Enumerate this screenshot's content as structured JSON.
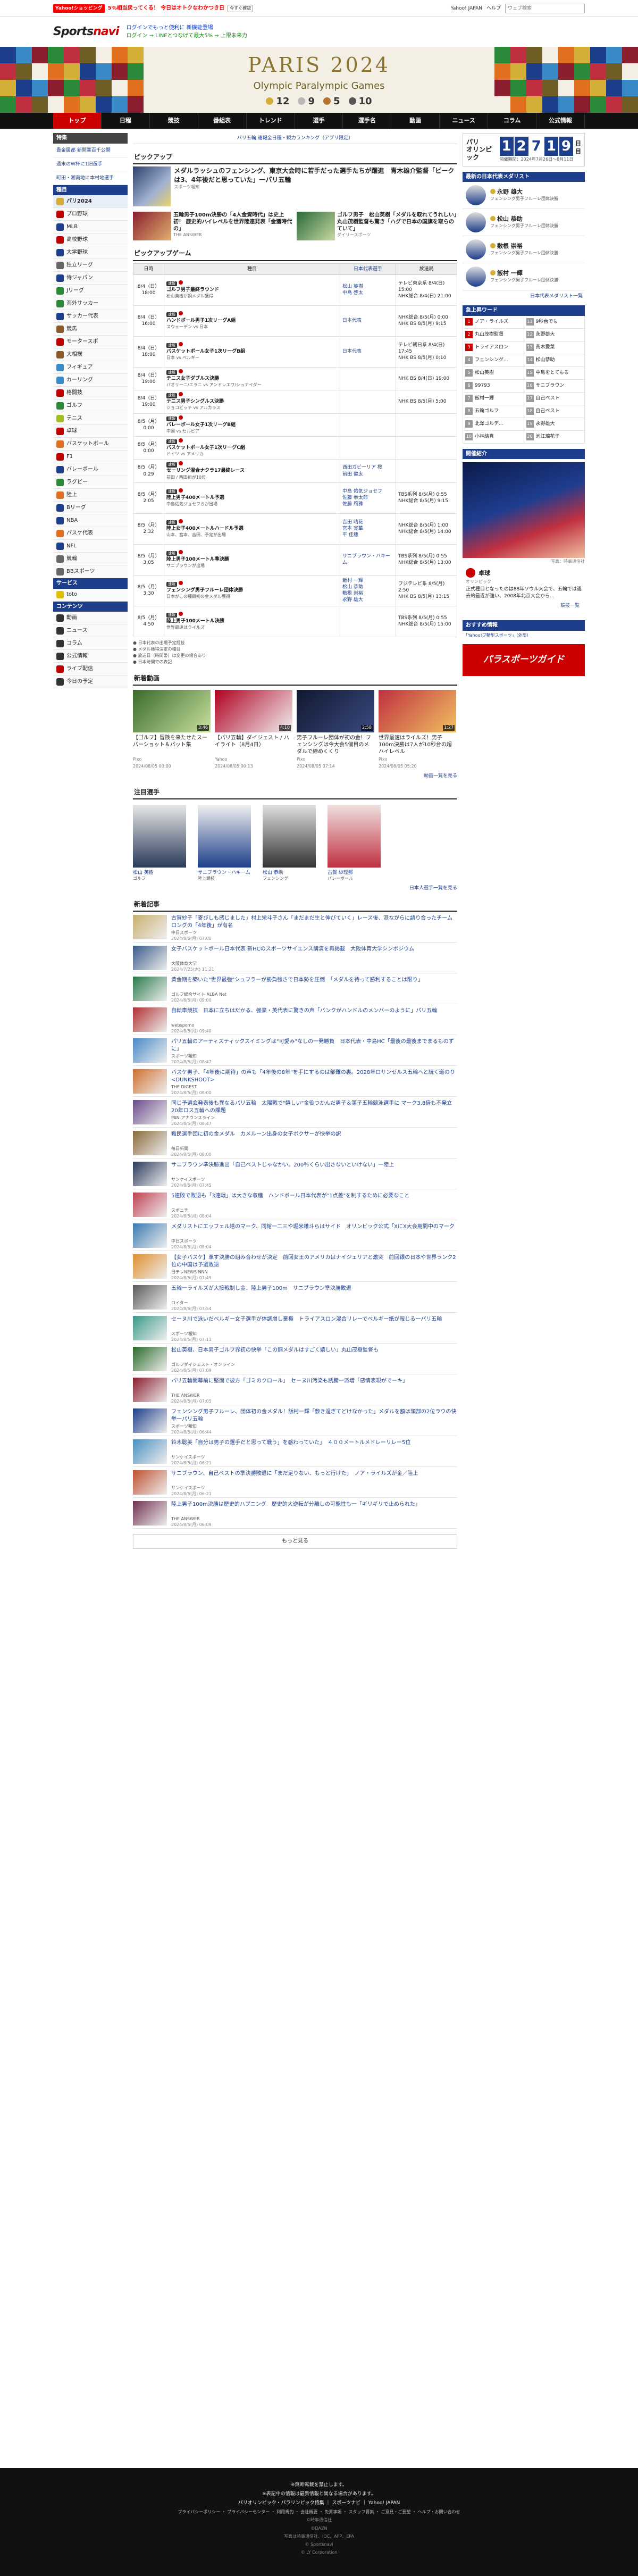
{
  "topbar": {
    "yahoo_logo": "Yahoo!ショッピング",
    "promo": "5%相当戻ってくる！ 今日はオトクなわかつき日",
    "promo_button": "今すぐ確認",
    "links": [
      "Yahoo! JAPAN",
      "ヘルプ"
    ],
    "search_placeholder": "ウェブ検索"
  },
  "header": {
    "logo_main": "Sports",
    "logo_sub": "navi",
    "line1": "ログインでもっと便利に 新機能登場",
    "line2": "ログイン ⇒ LINEとつなげて最大5% ⇒ 上限未来力"
  },
  "banner": {
    "title": "PARIS 2024",
    "subtitle": "Olympic Paralympic Games",
    "medals": [
      {
        "count": "12",
        "color": "#d4af37"
      },
      {
        "count": "9",
        "color": "#b8b8b8"
      },
      {
        "count": "5",
        "color": "#b87333"
      },
      {
        "count": "10",
        "color": "#555555"
      }
    ]
  },
  "global_nav": [
    "トップ",
    "日程",
    "競技",
    "番組表",
    "トレンド",
    "選手",
    "選手名",
    "動画",
    "ニュース",
    "コラム",
    "公式情報"
  ],
  "left_nav": {
    "special_header": "特集",
    "special_items": [
      "貴金属都 新開業百千公開",
      "週末のW杯に1旧選手",
      "町田・湘南地に本村地選手"
    ],
    "sports_header": "種目",
    "sports": [
      {
        "label": "パリ2024",
        "color": "#d4af37"
      },
      {
        "label": "プロ野球",
        "color": "#c00000"
      },
      {
        "label": "MLB",
        "color": "#1d3e8a"
      },
      {
        "label": "高校野球",
        "color": "#c00000"
      },
      {
        "label": "大学野球",
        "color": "#1d3e8a"
      },
      {
        "label": "独立リーグ",
        "color": "#666666"
      },
      {
        "label": "侍ジャパン",
        "color": "#1d3e8a"
      },
      {
        "label": "Jリーグ",
        "color": "#2a8a3a"
      },
      {
        "label": "海外サッカー",
        "color": "#2a8a3a"
      },
      {
        "label": "サッカー代表",
        "color": "#1d3e8a"
      },
      {
        "label": "競馬",
        "color": "#8a5a2a"
      },
      {
        "label": "モータースポ",
        "color": "#c00000"
      },
      {
        "label": "大相撲",
        "color": "#8a5a2a"
      },
      {
        "label": "フィギュア",
        "color": "#3a8ac8"
      },
      {
        "label": "カーリング",
        "color": "#3a8ac8"
      },
      {
        "label": "格闘技",
        "color": "#c00000"
      },
      {
        "label": "ゴルフ",
        "color": "#2a8a3a"
      },
      {
        "label": "テニス",
        "color": "#a0c020"
      },
      {
        "label": "卓球",
        "color": "#c00000"
      },
      {
        "label": "バスケットボール",
        "color": "#e07020"
      },
      {
        "label": "F1",
        "color": "#c00000"
      },
      {
        "label": "バレーボール",
        "color": "#1d3e8a"
      },
      {
        "label": "ラグビー",
        "color": "#2a8a3a"
      },
      {
        "label": "陸上",
        "color": "#e07020"
      },
      {
        "label": "Bリーグ",
        "color": "#1d3e8a"
      },
      {
        "label": "NBA",
        "color": "#1d3e8a"
      },
      {
        "label": "パスケ代表",
        "color": "#e07020"
      },
      {
        "label": "NFL",
        "color": "#1d3e8a"
      },
      {
        "label": "競輪",
        "color": "#666666"
      },
      {
        "label": "BBスポーツ",
        "color": "#666666"
      }
    ],
    "service_header": "サービス",
    "services": [
      {
        "label": "toto",
        "color": "#e0c000"
      }
    ],
    "content_header": "コンテンツ",
    "contents": [
      {
        "label": "動画",
        "color": "#333333"
      },
      {
        "label": "ニュース",
        "color": "#333333"
      },
      {
        "label": "コラム",
        "color": "#333333"
      },
      {
        "label": "公式情報",
        "color": "#333333"
      },
      {
        "label": "ライブ配信",
        "color": "#c00000"
      },
      {
        "label": "今日の予定",
        "color": "#333333"
      }
    ]
  },
  "breadcrumb": "パリ五輪 速報全日程・観力ランキング（アプリ限定）",
  "pickup": {
    "heading": "ピックアップ",
    "main": {
      "title": "メダルラッシュのフェンシング、東京大会時に若手だった選手たちが躍進　青木雄介監督「ピークは3、4年後だと思っていた」一パリ五輪",
      "source": "スポーツ報知"
    },
    "items": [
      {
        "title": "五輪男子100m決勝の「4人金資時代」は史上初！ 歴史的ハイレベルを世界陸連発表「金獲時代の」",
        "source": "THE ANSWER"
      },
      {
        "title": "ゴルフ男子　松山英樹「メダルを取れてうれしい」丸山茂樹監督も驚き「ハグで日本の国旗を取らのていて」",
        "source": "ダイリースポーツ"
      }
    ]
  },
  "games": {
    "heading": "ピックアップゲーム",
    "columns": [
      "日時",
      "種目",
      "日本代表選手",
      "放送局"
    ],
    "rows": [
      {
        "date": "8/4（日）",
        "time": "18:00",
        "tag": "速報",
        "event": "ゴルフ男子最終ラウンド",
        "sub": "松山英樹が銅メダル獲得",
        "players": "松山 英樹\n中島 啓太",
        "broadcast": "テレビ東京系 8/4(日) 15:00\nNHK総合 8/4(日) 21:00"
      },
      {
        "date": "8/4（日）",
        "time": "16:00",
        "tag": "速報",
        "event": "ハンドボール男子1次リーグA組",
        "sub": "スウェーデン vs 日本",
        "players": "日本代表",
        "broadcast": "NHK総合 8/5(月) 0:00\nNHK BS 8/5(月) 9:15"
      },
      {
        "date": "8/4（日）",
        "time": "18:00",
        "tag": "速報",
        "event": "バスケットボール女子1次リーグB組",
        "sub": "日本 vs ベルギー",
        "players": "日本代表",
        "broadcast": "テレビ朝日系 8/4(日) 17:45\nNHK BS 8/5(月) 0:10"
      },
      {
        "date": "8/4（日）",
        "time": "19:00",
        "tag": "速報",
        "event": "テニス女子ダブルス決勝",
        "sub": "パオリーニ/エラニ vs アンドレエワ/シュナイダー",
        "players": "",
        "broadcast": "NHK BS 8/4(日) 19:00"
      },
      {
        "date": "8/4（日）",
        "time": "19:00",
        "tag": "速報",
        "event": "テニス男子シングルス決勝",
        "sub": "ジョコビッチ vs アルカラス",
        "players": "",
        "broadcast": "NHK BS 8/5(月) 5:00"
      },
      {
        "date": "8/5（月）",
        "time": "0:00",
        "tag": "速報",
        "event": "バレーボール女子1次リーグB組",
        "sub": "中国 vs セルビア",
        "players": "",
        "broadcast": ""
      },
      {
        "date": "8/5（月）",
        "time": "0:00",
        "tag": "速報",
        "event": "バスケットボール女子1次リーグC組",
        "sub": "ドイツ vs アメリカ",
        "players": "",
        "broadcast": ""
      },
      {
        "date": "8/5（月）",
        "time": "0:29",
        "tag": "速報",
        "event": "セーリング混合ナクラ17最終レース",
        "sub": "前田 / 西田組が10位",
        "players": "西田ガビーリア 桜\n前田 健太",
        "broadcast": ""
      },
      {
        "date": "8/5（月）",
        "time": "2:05",
        "tag": "速報",
        "event": "陸上男子400メートル予選",
        "sub": "中島佑気ジョセフらが出場",
        "players": "中島 佑気ジョセフ\n佐藤 拳太郎\n佐藤 風雅",
        "broadcast": "TBS系列 8/5(月) 0:55\nNHK総合 8/5(月) 9:15"
      },
      {
        "date": "8/5（月）",
        "time": "2:32",
        "tag": "速報",
        "event": "陸上女子400メートルハードル予選",
        "sub": "山本、宮本、吉田、予定が出場",
        "players": "吉田 晴花\n宮本 実華\n平 佳穂",
        "broadcast": "NHK総合 8/5(月) 1:00\nNHK総合 8/5(月) 14:00"
      },
      {
        "date": "8/5（月）",
        "time": "3:05",
        "tag": "速報",
        "event": "陸上男子100メートル準決勝",
        "sub": "サニブラウンが出場",
        "players": "サニブラウン・ハキーム",
        "broadcast": "TBS系列 8/5(月) 0:55\nNHK総合 8/5(月) 13:00"
      },
      {
        "date": "8/5（月）",
        "time": "3:30",
        "tag": "速報",
        "event": "フェンシング男子フルーレ団体決勝",
        "sub": "日本がこの種目初の金メダル獲得",
        "players": "飯村 一輝\n松山 恭助\n敷根 崇裕\n永野 雄大",
        "broadcast": "フジテレビ系 8/5(月) 2:50\nNHK BS 8/5(月) 13:15"
      },
      {
        "date": "8/5（月）",
        "time": "4:50",
        "tag": "速報",
        "event": "陸上男子100メートル決勝",
        "sub": "世界最速はライルズ",
        "players": "",
        "broadcast": "TBS系列 8/5(月) 0:55\nNHK総合 8/5(月) 15:00"
      }
    ],
    "legend": [
      "● 日本代表の出場予定競技",
      "● メダル獲得決定の種目",
      "● 放送日（時間帯）は変更の場合あり",
      "● 日本時間での表記"
    ]
  },
  "videos": {
    "heading": "新着動画",
    "items": [
      {
        "title": "【ゴルフ】冒険を来たせたスーパーショット＆パット集",
        "source": "Pixo",
        "date": "2024/08/05 00:00",
        "duration": "3:46"
      },
      {
        "title": "【パリ五輪】ダイジェスト / ハイライト（8月4日）",
        "source": "Yahoo",
        "date": "2024/08/05 00:13",
        "duration": "4:10"
      },
      {
        "title": "男子フルーレ団体が初の金！フェンシングは今大会5個目のメダルで締めくくり",
        "source": "Pixo",
        "date": "2024/08/05 07:14",
        "duration": "2:58"
      },
      {
        "title": "世界最速はライルズ！男子100m決勝は7人が10秒台の超ハイレベル",
        "source": "Pixo",
        "date": "2024/08/05 05:20",
        "duration": "1:27"
      }
    ],
    "more": "動画一覧を見る"
  },
  "athletes": {
    "heading": "注目選手",
    "items": [
      {
        "name": "松山 英樹",
        "sport": "ゴルフ"
      },
      {
        "name": "サニブラウン・ハキーム",
        "sport": "陸上競技"
      },
      {
        "name": "松山 恭助",
        "sport": "フェンシング"
      },
      {
        "name": "古賀 紗理那",
        "sport": "バレーボール"
      }
    ],
    "more": "日本人選手一覧を見る"
  },
  "news": {
    "heading": "新着記事",
    "items": [
      {
        "title": "古賀紗子「寄びしも感じました」村上栄斗子さん「まだまだ生と伸びていく」レース後、涙ながらに語り合ったチームロングの「4年後」が有名",
        "source": "中日スポーツ",
        "date": "2024/8/5(月) 07:00"
      },
      {
        "title": "女子バスケットボール日本代表 新HCのスポーツサイエンス講演を再掲載　大阪体育大学シンポジウム",
        "source": "大阪体育大学",
        "date": "2024/7/25(木) 11:21"
      },
      {
        "title": "黄金期を築いた\"世界最強\"シュフラーが勝負強さで日本勢を圧倒　「メダルを待って勝利することは限り」",
        "source": "ゴルフ総合サイト ALBA Net",
        "date": "2024/8/5(月) 09:00"
      },
      {
        "title": "自転車競技　日本に立ちはだかる、強豪・英代表に驚きの声「バンクがハンドルのメンバーのように」パリ五輪",
        "source": "webspomo",
        "date": "2024/8/5(月) 09:40"
      },
      {
        "title": "パリ五輪のアーティスティックスイミングは\"可愛み\"なしの一発勝負　日本代表・中島HC「最後の最後までまるものずに」",
        "source": "スポーツ報知",
        "date": "2024/8/5(月) 08:47"
      },
      {
        "title": "バスケ男子、「4年後に期待」の声も「4年後の8年\"を手にするのは部難の裏。2028年ロサンゼルス五輪へと続く道のり<DUNKSHOOT>",
        "source": "THE DIGEST",
        "date": "2024/8/5(月) 08:00"
      },
      {
        "title": "同じ予選会発表後も異なるパリ五輪　太陽戦で\"嬉しい\"金役つかんだ男子＆第子五輪競泳選手に マーク3.8倍も不発立　20年ロス五輪への課題",
        "source": "PAN アナウンスライン",
        "date": "2024/8/5(月) 08:47"
      },
      {
        "title": "難民選手団に初の金メダル　カメルーン出身の女子ボクサーが快挙の訳",
        "source": "毎日新聞",
        "date": "2024/8/5(月) 08:00"
      },
      {
        "title": "サニブラウン準決勝進出「自己ベストじゃなかい。200％くらい出さないといけない」一陸上",
        "source": "サンケイスポーツ",
        "date": "2024/8/5(月) 07:45"
      },
      {
        "title": "5連敗で敗退も「3連戦」は大きな収穫　ハンドボール日本代表が\"1点差\"を制するために必要なこと",
        "source": "スポニチ",
        "date": "2024/8/5(月) 08:04"
      },
      {
        "title": "メダリストにエッフェル塔のマーク、同館一二三や堀米雄斗らはサイド　オリンピック公式「XにX大会期間中のマーク",
        "source": "中日スポーツ",
        "date": "2024/8/5(月) 08:04"
      },
      {
        "title": "【女子バスケ】革す決勝の組み合わせが決定　前回女王のアメリカはナイジェリアと激突　前回銀の日本や世界ランク2位の中国は予選敗退",
        "source": "日テレNEWS NNN",
        "date": "2024/8/5(月) 07:49"
      },
      {
        "title": "五輪一ライルズが大接戦制し金、陸上男子100m　サニブラウン準決勝敗退",
        "source": "ロイター",
        "date": "2024/8/5(月) 07:54"
      },
      {
        "title": "セーヌ川で泳いだベルギー女子選手が体調崩し棄権　トライアスロン混合リレーでベルギー紙が報じる一パリ五輪",
        "source": "スポーツ報知",
        "date": "2024/8/5(月) 07:11"
      },
      {
        "title": "松山英樹、日本男子ゴルフ界初の快挙「この銅メダルはすごく嬉しい」丸山茂樹監督も",
        "source": "ゴルフダイジェスト・オンライン",
        "date": "2024/8/5(月) 07:09"
      },
      {
        "title": "パリ五輪開幕前に堅固で彼方「ゴミのクロール」　セーヌ川汚染も誘騰一派増「感情表現がでーキ」",
        "source": "THE ANSWER",
        "date": "2024/8/5(月) 07:05"
      },
      {
        "title": "フェンシング男子フルーレ、団体初の金メダル！飯村一輝「敷き過ぎてどけなかった」メダルを額は頭部の2位ラウの快挙一パリ五輪",
        "source": "スポーツ報知",
        "date": "2024/8/5(月) 06:44"
      },
      {
        "title": "鈴木聡美「自分は男子の選手だと思って戦う」を感わっていた」　４００メートルメドレーリレー5位",
        "source": "サンケイスポーツ",
        "date": "2024/8/5(月) 06:21"
      },
      {
        "title": "サニブラウン、自己ベストの準決勝敗退に「まだ足りない、もっと行けた」　ノア・ライルズが金／陸上",
        "source": "サンケイスポーツ",
        "date": "2024/8/5(月) 06:21"
      },
      {
        "title": "陸上男子100m決勝は歴史的ハプニング　歴史的大逆転が分離しの可能性も一「ギリギリで止められた」",
        "source": "THE ANSWER",
        "date": "2024/8/5(月) 06:09"
      }
    ],
    "more": "もっと見る"
  },
  "sidebar": {
    "day": {
      "label1": "パリ",
      "label2": "オリンピック",
      "digits": [
        "1",
        "2",
        "7",
        "1",
        "9"
      ],
      "suffix": "日目",
      "period": "開催期間：2024年7月26日〜8月11日"
    },
    "medalists_header": "最新の日本代表メダリスト",
    "medalists": [
      {
        "name": "永野 雄大",
        "sport": "フェンシング男子フルーレ団体決勝",
        "color": "#d4af37"
      },
      {
        "name": "松山 恭助",
        "sport": "フェンシング男子フルーレ団体決勝",
        "color": "#d4af37"
      },
      {
        "name": "敷根 崇裕",
        "sport": "フェンシング男子フルーレ団体決勝",
        "color": "#d4af37"
      },
      {
        "name": "飯村 一輝",
        "sport": "フェンシング男子フルーレ団体決勝",
        "color": "#d4af37"
      }
    ],
    "medalists_more": "日本代表メダリスト一覧",
    "ranking_header": "急上昇ワード",
    "ranking": [
      {
        "rank": "1",
        "word": "ノア・ライルズ"
      },
      {
        "rank": "2",
        "word": "丸山茂樹監督"
      },
      {
        "rank": "3",
        "word": "トライアスロン"
      },
      {
        "rank": "4",
        "word": "フェンシング..."
      },
      {
        "rank": "5",
        "word": "松山英樹"
      },
      {
        "rank": "6",
        "word": "99793"
      },
      {
        "rank": "7",
        "word": "飯村一輝"
      },
      {
        "rank": "8",
        "word": "五輪ゴルフ"
      },
      {
        "rank": "9",
        "word": "北澤ゴルデ..."
      },
      {
        "rank": "10",
        "word": "小林結真"
      },
      {
        "rank": "11",
        "word": "9秒台でも"
      },
      {
        "rank": "12",
        "word": "永野雄大"
      },
      {
        "rank": "13",
        "word": "荒木愛菜"
      },
      {
        "rank": "14",
        "word": "松山恭助"
      },
      {
        "rank": "15",
        "word": "中島をとてもる"
      },
      {
        "rank": "16",
        "word": "サニブラウン"
      },
      {
        "rank": "17",
        "word": "自己ベスト"
      },
      {
        "rank": "18",
        "word": "自己ベスト"
      },
      {
        "rank": "19",
        "word": "永野雄大"
      },
      {
        "rank": "20",
        "word": "池江璃花子"
      }
    ],
    "feature_header": "開催紹介",
    "feature_caption": "写真：時事通信社",
    "feature_name": "卓球",
    "feature_sport": "オリンピック",
    "feature_text": "正式種目となったのは88年ソウル大会で、五輪では過去約最近が強い、2008年北京大会から...",
    "feature_more": "競技一覧",
    "promo_header": "おすすめ情報",
    "promo_sub": "「Yahoo!ブ動型スポーツ」（外部）",
    "promo_title": "パラスポーツガイド"
  },
  "footer": {
    "line1": "※無断転載を禁止します。",
    "line2": "※表記中の情報は最新情報と異なる場合があります。",
    "links": "パリオリンピック・パラリンピック特集 ｜ スポーツナビ ｜ Yahoo! JAPAN",
    "links2": "プライバシーポリシー ・ プライバシーセンター ・ 利用規約 ・ 会社概要 ・ 免責事項 ・ スタッフ募集 ・ ご意見・ご要望 ・ ヘルプ・お問い合わせ",
    "lines": [
      "©時事通信社",
      "©DAZN",
      "写真は時事通信社、IOC、AFP、EPA",
      "© Sportsnavi",
      "© LY Corporation"
    ]
  }
}
